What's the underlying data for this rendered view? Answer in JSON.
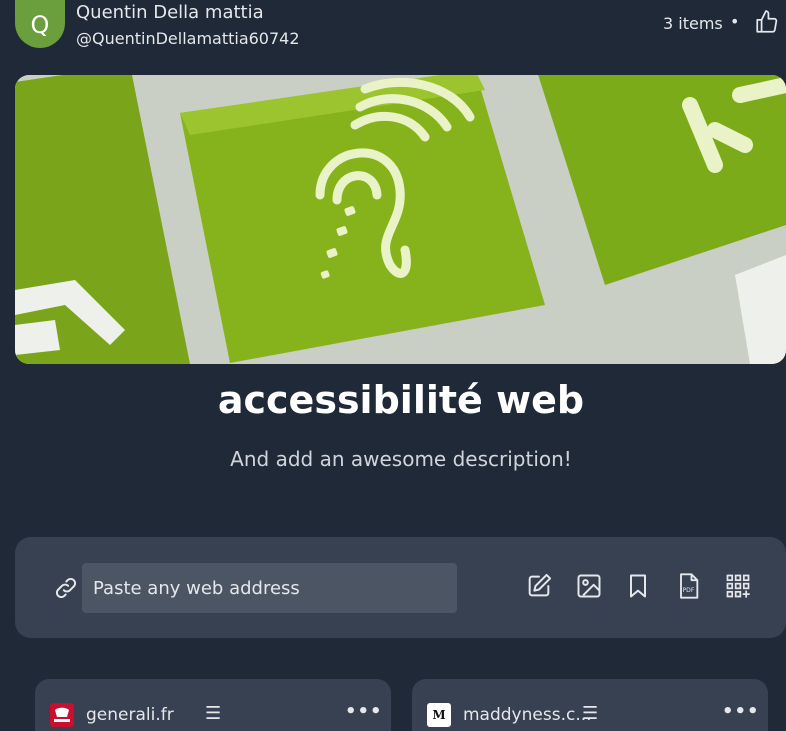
{
  "user": {
    "initial": "Q",
    "name": "Quentin Della mattia",
    "handle": "@QuentinDellamattia60742",
    "avatar_color": "#6b9e3c"
  },
  "board": {
    "items_count": "3 items",
    "separator": "•",
    "title": "accessibilité web",
    "description": "And add an awesome description!",
    "cover_color": "#7cab1a"
  },
  "add_bar": {
    "placeholder": "Paste any web address",
    "tools": [
      "edit-note-icon",
      "image-icon",
      "bookmark-icon",
      "pdf-icon",
      "apps-grid-icon"
    ]
  },
  "cards": [
    {
      "favicon": "GENERALI",
      "domain": "generali.fr",
      "favicon_color": "#c8102e"
    },
    {
      "favicon": "M",
      "domain": "maddyness.c...",
      "favicon_color": "#ffffff"
    }
  ],
  "colors": {
    "background": "#1f2937",
    "panel": "#374151",
    "input": "#4b5563",
    "accent": "#7cab1a"
  }
}
